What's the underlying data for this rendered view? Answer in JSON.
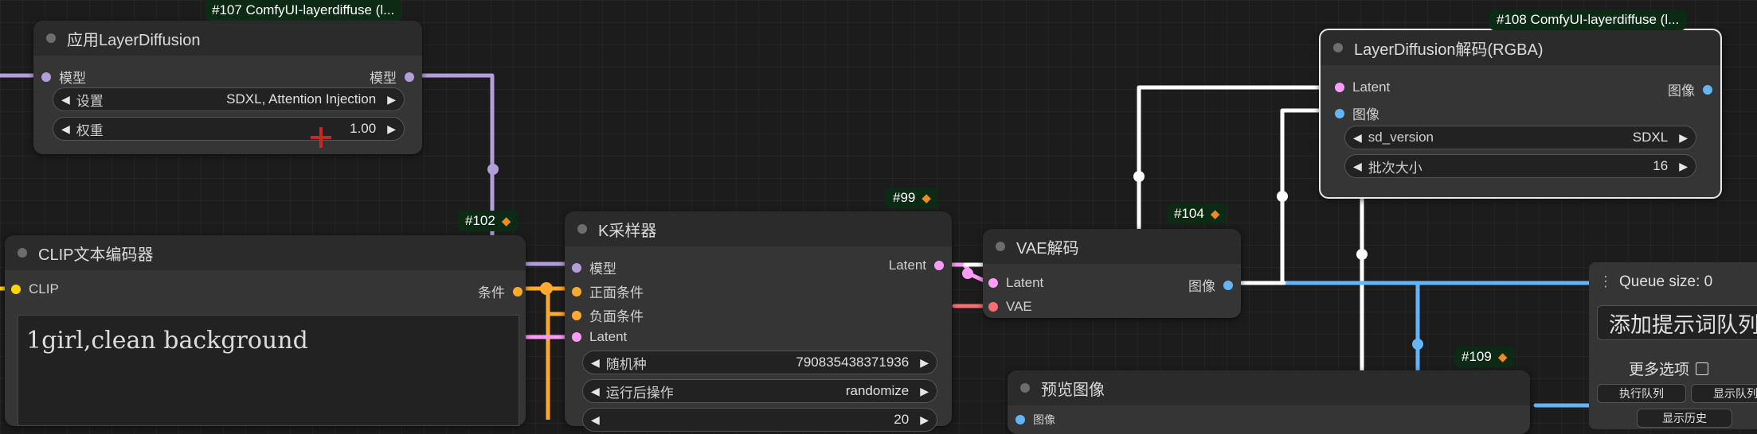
{
  "node107": {
    "badge": "#107 ComfyUI-layerdiffuse (l...",
    "title": "应用LayerDiffusion",
    "input_model": "模型",
    "output_model": "模型",
    "setting_label": "设置",
    "setting_value": "SDXL, Attention Injection",
    "weight_label": "权重",
    "weight_value": "1.00"
  },
  "node102": {
    "badge": "#102",
    "title": "CLIP文本编码器",
    "input_clip": "CLIP",
    "output_cond": "条件",
    "prompt_text": "1girl,clean background"
  },
  "node99": {
    "badge": "#99",
    "title": "K采样器",
    "in_model": "模型",
    "in_positive": "正面条件",
    "in_negative": "负面条件",
    "in_latent": "Latent",
    "out_latent": "Latent",
    "seed_label": "随机种",
    "seed_value": "790835438371936",
    "after_label": "运行后操作",
    "after_value": "randomize",
    "steps_value": "20"
  },
  "node104": {
    "badge": "#104",
    "title": "VAE解码",
    "in_latent": "Latent",
    "in_vae": "VAE",
    "out_image": "图像"
  },
  "node108": {
    "badge": "#108 ComfyUI-layerdiffuse (l...",
    "title": "LayerDiffusion解码(RGBA)",
    "in_latent": "Latent",
    "in_image": "图像",
    "out_image": "图像",
    "sd_label": "sd_version",
    "sd_value": "SDXL",
    "batch_label": "批次大小",
    "batch_value": "16"
  },
  "node109": {
    "badge": "#109",
    "title": "预览图像",
    "in_image": "图像"
  },
  "queue": {
    "size_text": "Queue size: 0",
    "prompt_button": "添加提示词队列",
    "more_options": "更多选项",
    "execute_queue": "执行队列",
    "show_queue": "显示队列",
    "show_history": "显示历史"
  },
  "colors": {
    "model": "#b39ddb",
    "clip": "#ffd500",
    "conditioning": "#ffa931",
    "latent": "#ff9cf9",
    "image": "#64b5f6",
    "vae": "#ff6e6e",
    "badge_bg": "#0d2a14",
    "badge_icon": "#f08a24"
  },
  "icons": {
    "badge_source": "fox-icon",
    "widget_arrows": "triangle-left-right-icons",
    "queue_menu": "vertical-dots-icon"
  }
}
